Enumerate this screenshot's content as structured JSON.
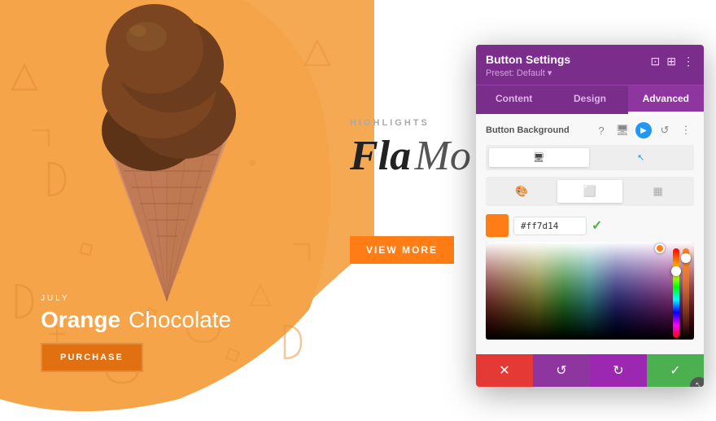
{
  "background": {
    "orange_color": "#F5A44A",
    "blob_color": "#F5A44A"
  },
  "highlight": {
    "label": "HIGHLIGHTS",
    "title_bold": "Fla",
    "title_regular": "Mo"
  },
  "view_button": {
    "label": "VIEW MORE"
  },
  "bottom": {
    "month": "JULY",
    "flavor_orange": "Orange",
    "flavor_chocolate": "Chocolate",
    "purchase_label": "PURCHASE"
  },
  "panel": {
    "title": "Button Settings",
    "preset": "Preset: Default ▾",
    "tabs": [
      {
        "label": "Content",
        "active": false
      },
      {
        "label": "Design",
        "active": false
      },
      {
        "label": "Advanced",
        "active": true
      }
    ],
    "field_label": "Button Background",
    "color_hex": "#ff7d14",
    "close_icon": "✕",
    "reset_icon": "↺",
    "redo_icon": "↻",
    "check_icon": "✓",
    "drag_icon": "⤡",
    "header_icons": [
      "⊡",
      "⊞",
      "⋮"
    ],
    "actions": [
      {
        "icon": "✕",
        "color": "red"
      },
      {
        "icon": "↺",
        "color": "purple"
      },
      {
        "icon": "↻",
        "color": "purple2"
      },
      {
        "icon": "✓",
        "color": "green"
      }
    ]
  }
}
